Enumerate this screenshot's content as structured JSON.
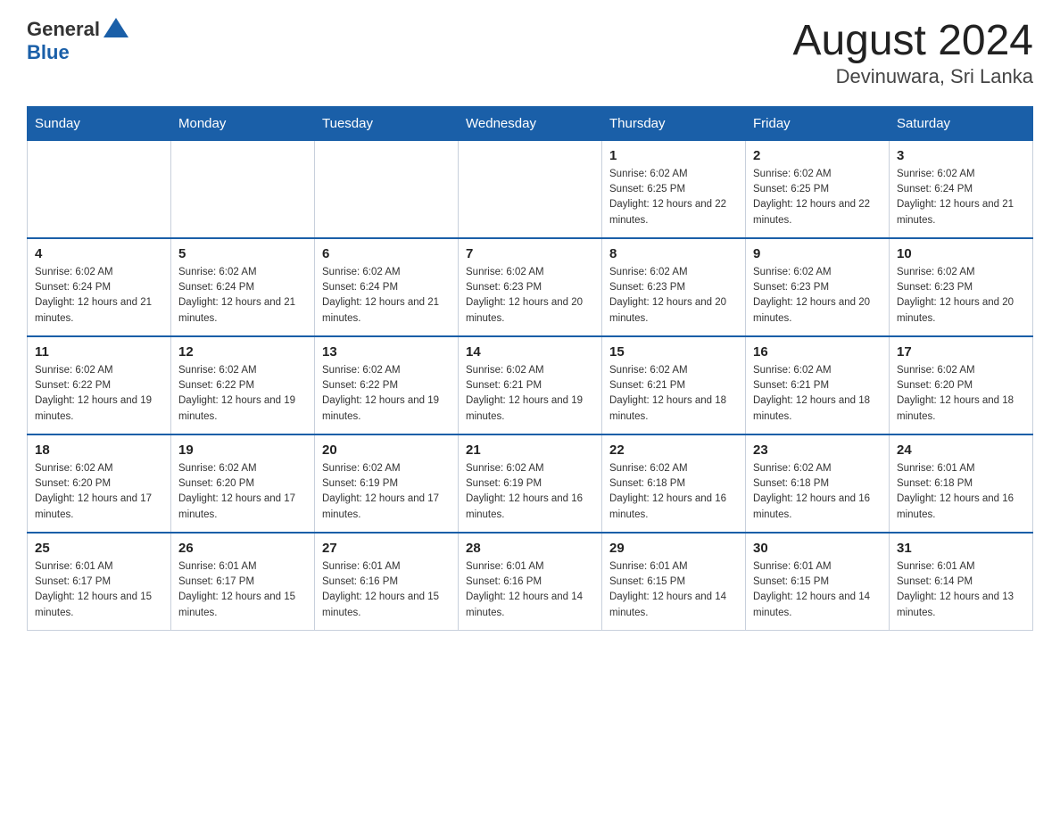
{
  "header": {
    "logo_general": "General",
    "logo_blue": "Blue",
    "month_title": "August 2024",
    "location": "Devinuwara, Sri Lanka"
  },
  "weekdays": [
    "Sunday",
    "Monday",
    "Tuesday",
    "Wednesday",
    "Thursday",
    "Friday",
    "Saturday"
  ],
  "weeks": [
    [
      {
        "day": "",
        "sunrise": "",
        "sunset": "",
        "daylight": ""
      },
      {
        "day": "",
        "sunrise": "",
        "sunset": "",
        "daylight": ""
      },
      {
        "day": "",
        "sunrise": "",
        "sunset": "",
        "daylight": ""
      },
      {
        "day": "",
        "sunrise": "",
        "sunset": "",
        "daylight": ""
      },
      {
        "day": "1",
        "sunrise": "Sunrise: 6:02 AM",
        "sunset": "Sunset: 6:25 PM",
        "daylight": "Daylight: 12 hours and 22 minutes."
      },
      {
        "day": "2",
        "sunrise": "Sunrise: 6:02 AM",
        "sunset": "Sunset: 6:25 PM",
        "daylight": "Daylight: 12 hours and 22 minutes."
      },
      {
        "day": "3",
        "sunrise": "Sunrise: 6:02 AM",
        "sunset": "Sunset: 6:24 PM",
        "daylight": "Daylight: 12 hours and 21 minutes."
      }
    ],
    [
      {
        "day": "4",
        "sunrise": "Sunrise: 6:02 AM",
        "sunset": "Sunset: 6:24 PM",
        "daylight": "Daylight: 12 hours and 21 minutes."
      },
      {
        "day": "5",
        "sunrise": "Sunrise: 6:02 AM",
        "sunset": "Sunset: 6:24 PM",
        "daylight": "Daylight: 12 hours and 21 minutes."
      },
      {
        "day": "6",
        "sunrise": "Sunrise: 6:02 AM",
        "sunset": "Sunset: 6:24 PM",
        "daylight": "Daylight: 12 hours and 21 minutes."
      },
      {
        "day": "7",
        "sunrise": "Sunrise: 6:02 AM",
        "sunset": "Sunset: 6:23 PM",
        "daylight": "Daylight: 12 hours and 20 minutes."
      },
      {
        "day": "8",
        "sunrise": "Sunrise: 6:02 AM",
        "sunset": "Sunset: 6:23 PM",
        "daylight": "Daylight: 12 hours and 20 minutes."
      },
      {
        "day": "9",
        "sunrise": "Sunrise: 6:02 AM",
        "sunset": "Sunset: 6:23 PM",
        "daylight": "Daylight: 12 hours and 20 minutes."
      },
      {
        "day": "10",
        "sunrise": "Sunrise: 6:02 AM",
        "sunset": "Sunset: 6:23 PM",
        "daylight": "Daylight: 12 hours and 20 minutes."
      }
    ],
    [
      {
        "day": "11",
        "sunrise": "Sunrise: 6:02 AM",
        "sunset": "Sunset: 6:22 PM",
        "daylight": "Daylight: 12 hours and 19 minutes."
      },
      {
        "day": "12",
        "sunrise": "Sunrise: 6:02 AM",
        "sunset": "Sunset: 6:22 PM",
        "daylight": "Daylight: 12 hours and 19 minutes."
      },
      {
        "day": "13",
        "sunrise": "Sunrise: 6:02 AM",
        "sunset": "Sunset: 6:22 PM",
        "daylight": "Daylight: 12 hours and 19 minutes."
      },
      {
        "day": "14",
        "sunrise": "Sunrise: 6:02 AM",
        "sunset": "Sunset: 6:21 PM",
        "daylight": "Daylight: 12 hours and 19 minutes."
      },
      {
        "day": "15",
        "sunrise": "Sunrise: 6:02 AM",
        "sunset": "Sunset: 6:21 PM",
        "daylight": "Daylight: 12 hours and 18 minutes."
      },
      {
        "day": "16",
        "sunrise": "Sunrise: 6:02 AM",
        "sunset": "Sunset: 6:21 PM",
        "daylight": "Daylight: 12 hours and 18 minutes."
      },
      {
        "day": "17",
        "sunrise": "Sunrise: 6:02 AM",
        "sunset": "Sunset: 6:20 PM",
        "daylight": "Daylight: 12 hours and 18 minutes."
      }
    ],
    [
      {
        "day": "18",
        "sunrise": "Sunrise: 6:02 AM",
        "sunset": "Sunset: 6:20 PM",
        "daylight": "Daylight: 12 hours and 17 minutes."
      },
      {
        "day": "19",
        "sunrise": "Sunrise: 6:02 AM",
        "sunset": "Sunset: 6:20 PM",
        "daylight": "Daylight: 12 hours and 17 minutes."
      },
      {
        "day": "20",
        "sunrise": "Sunrise: 6:02 AM",
        "sunset": "Sunset: 6:19 PM",
        "daylight": "Daylight: 12 hours and 17 minutes."
      },
      {
        "day": "21",
        "sunrise": "Sunrise: 6:02 AM",
        "sunset": "Sunset: 6:19 PM",
        "daylight": "Daylight: 12 hours and 16 minutes."
      },
      {
        "day": "22",
        "sunrise": "Sunrise: 6:02 AM",
        "sunset": "Sunset: 6:18 PM",
        "daylight": "Daylight: 12 hours and 16 minutes."
      },
      {
        "day": "23",
        "sunrise": "Sunrise: 6:02 AM",
        "sunset": "Sunset: 6:18 PM",
        "daylight": "Daylight: 12 hours and 16 minutes."
      },
      {
        "day": "24",
        "sunrise": "Sunrise: 6:01 AM",
        "sunset": "Sunset: 6:18 PM",
        "daylight": "Daylight: 12 hours and 16 minutes."
      }
    ],
    [
      {
        "day": "25",
        "sunrise": "Sunrise: 6:01 AM",
        "sunset": "Sunset: 6:17 PM",
        "daylight": "Daylight: 12 hours and 15 minutes."
      },
      {
        "day": "26",
        "sunrise": "Sunrise: 6:01 AM",
        "sunset": "Sunset: 6:17 PM",
        "daylight": "Daylight: 12 hours and 15 minutes."
      },
      {
        "day": "27",
        "sunrise": "Sunrise: 6:01 AM",
        "sunset": "Sunset: 6:16 PM",
        "daylight": "Daylight: 12 hours and 15 minutes."
      },
      {
        "day": "28",
        "sunrise": "Sunrise: 6:01 AM",
        "sunset": "Sunset: 6:16 PM",
        "daylight": "Daylight: 12 hours and 14 minutes."
      },
      {
        "day": "29",
        "sunrise": "Sunrise: 6:01 AM",
        "sunset": "Sunset: 6:15 PM",
        "daylight": "Daylight: 12 hours and 14 minutes."
      },
      {
        "day": "30",
        "sunrise": "Sunrise: 6:01 AM",
        "sunset": "Sunset: 6:15 PM",
        "daylight": "Daylight: 12 hours and 14 minutes."
      },
      {
        "day": "31",
        "sunrise": "Sunrise: 6:01 AM",
        "sunset": "Sunset: 6:14 PM",
        "daylight": "Daylight: 12 hours and 13 minutes."
      }
    ]
  ]
}
